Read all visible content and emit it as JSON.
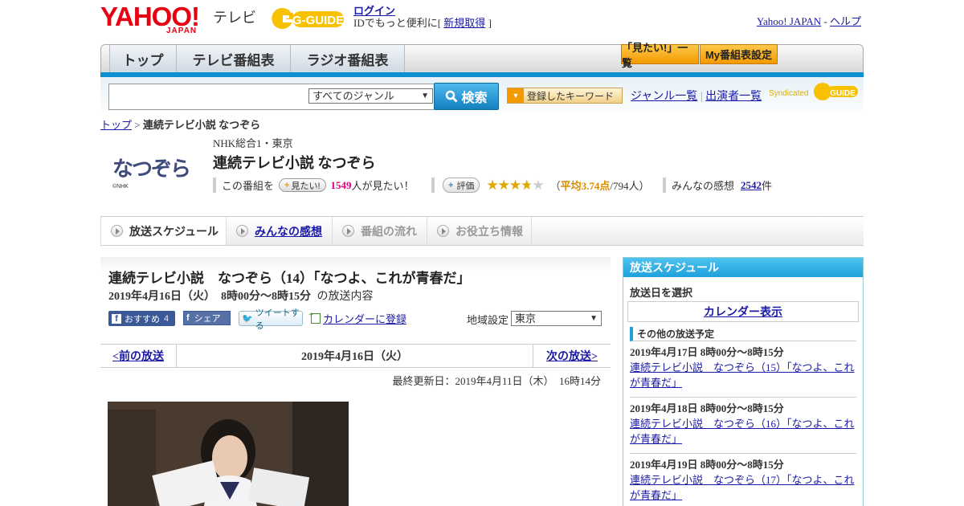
{
  "header": {
    "yahoo_logo": "YAHOO!",
    "yahoo_japan": "JAPAN",
    "tv_label": "テレビ",
    "gguide_logo": "G-GUIDE",
    "login_link": "ログイン",
    "login_text_prefix": "IDでもっと便利に[",
    "new_register_link": "新規取得",
    "login_text_suffix": "]",
    "yahoo_japan_link": "Yahoo! JAPAN",
    "separator": "-",
    "help_link": "ヘルプ"
  },
  "nav": {
    "tabs": [
      "トップ",
      "テレビ番組表",
      "ラジオ番組表"
    ],
    "mitai_list": "「見たい!」一覧",
    "my_schedule": "My番組表設定"
  },
  "search": {
    "genre_selected": "すべてのジャンル",
    "search_button": "検索",
    "keyword_button": "登録したキーワード",
    "genre_list_link": "ジャンル一覧",
    "performer_list_link": "出演者一覧",
    "syndicated": "Syndicated"
  },
  "breadcrumb": {
    "top": "トップ",
    "sep": ">",
    "current": "連続テレビ小説 なつぞら"
  },
  "program": {
    "thumb_logo_text": "なつぞら",
    "thumb_caption": "©NHK",
    "channel": "NHK総合1・東京",
    "title": "連続テレビ小説 なつぞら",
    "this_program": "この番組を",
    "mitai_button": "見たい!",
    "mitai_count": "1549",
    "mitai_suffix": "人が見たい！",
    "rate_button": "評価",
    "rating_value": 3.74,
    "avg_prefix": "（",
    "avg_label": "平均3.74点",
    "avg_count": "/794人）",
    "impressions_label": "みんなの感想",
    "impressions_count": "2542",
    "impressions_suffix": "件"
  },
  "program_tabs": [
    {
      "label": "放送スケジュール",
      "active": true
    },
    {
      "label": "みんなの感想",
      "link": true
    },
    {
      "label": "番組の流れ",
      "disabled": true
    },
    {
      "label": "お役立ち情報",
      "disabled": true
    }
  ],
  "episode": {
    "title": "連続テレビ小説　なつぞら（14）「なつよ、これが青春だ」",
    "datetime": "2019年4月16日（火）　8時00分～8時15分",
    "datetime_suffix": "の放送内容",
    "recommend_button": "おすすめ",
    "recommend_count": "4",
    "share_button": "シェア",
    "tweet_button": "ツイートする",
    "calendar_link": "カレンダーに登録",
    "region_label": "地域設定",
    "region_value": "東京",
    "prev_link": "<前の放送",
    "current_date": "2019年4月16日（火）",
    "next_link": "次の放送>",
    "last_updated": "最終更新日：2019年4月11日（木）　16時14分"
  },
  "sidebar": {
    "title": "放送スケジュール",
    "select_date": "放送日を選択",
    "calendar_link": "カレンダー表示",
    "other_schedule": "その他の放送予定",
    "items": [
      {
        "datetime": "2019年4月17日  8時00分～8時15分",
        "title": "連続テレビ小説　なつぞら（15）「なつよ、これが青春だ」"
      },
      {
        "datetime": "2019年4月18日  8時00分～8時15分",
        "title": "連続テレビ小説　なつぞら（16）「なつよ、これが青春だ」"
      },
      {
        "datetime": "2019年4月19日  8時00分～8時15分",
        "title": "連続テレビ小説　なつぞら（17）「なつよ、これが青春だ」"
      }
    ]
  },
  "colors": {
    "yahoo_red": "#e60012",
    "accent_blue": "#0a8fd0",
    "link": "#1a1aa6",
    "pink_count": "#e6007e",
    "rating_orange": "#d98c00"
  }
}
